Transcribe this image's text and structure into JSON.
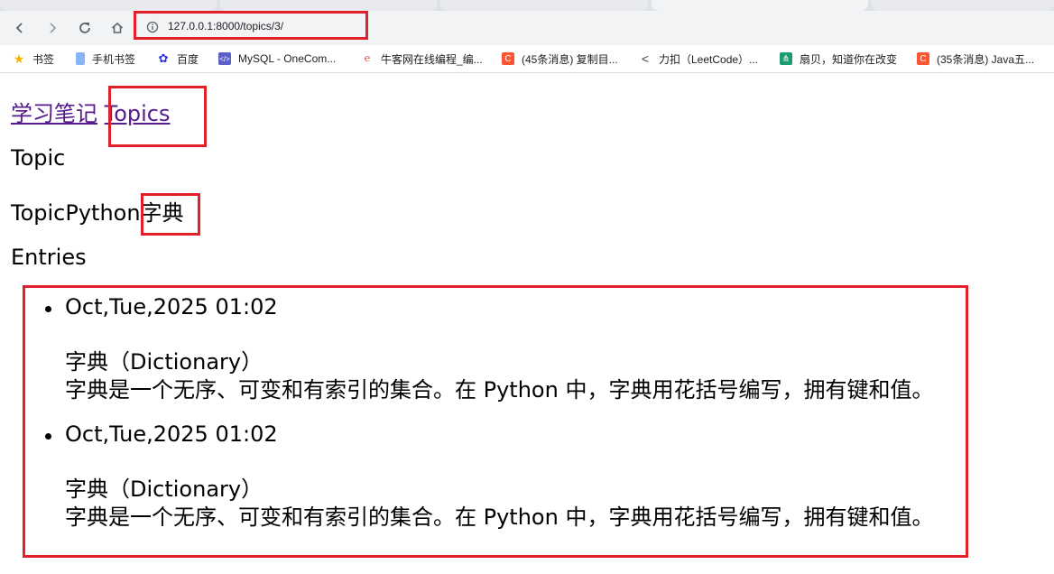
{
  "browser": {
    "url": "127.0.0.1:8000/topics/3/"
  },
  "bookmarks": [
    {
      "label": "书签",
      "icon": "star-icon"
    },
    {
      "label": "手机书签",
      "icon": "folder-icon"
    },
    {
      "label": "百度",
      "icon": "baidu-icon"
    },
    {
      "label": "MySQL - OneCom...",
      "icon": "code-icon"
    },
    {
      "label": "牛客网在线编程_编...",
      "icon": "nowcoder-icon"
    },
    {
      "label": "(45条消息) 复制目...",
      "icon": "csdn-icon"
    },
    {
      "label": "力扣（LeetCode）...",
      "icon": "leetcode-icon"
    },
    {
      "label": "扇贝，知道你在改变",
      "icon": "shanbay-icon"
    },
    {
      "label": "(35条消息) Java五...",
      "icon": "csdn-icon"
    }
  ],
  "page": {
    "home_link": "学习笔记",
    "topics_link": "Topics",
    "topic_heading": "Topic",
    "topic_name_line": "TopicPython字典",
    "entries_heading": "Entries",
    "entries": [
      {
        "date": "Oct,Tue,2025 01:02",
        "title": "字典（Dictionary）",
        "text": "字典是一个无序、可变和有索引的集合。在 Python 中，字典用花括号编写，拥有键和值。"
      },
      {
        "date": "Oct,Tue,2025 01:02",
        "title": "字典（Dictionary）",
        "text": "字典是一个无序、可变和有索引的集合。在 Python 中，字典用花括号编写，拥有键和值。"
      }
    ]
  },
  "colors": {
    "annotation": "#e3202a",
    "visited_link": "#551a8b"
  }
}
